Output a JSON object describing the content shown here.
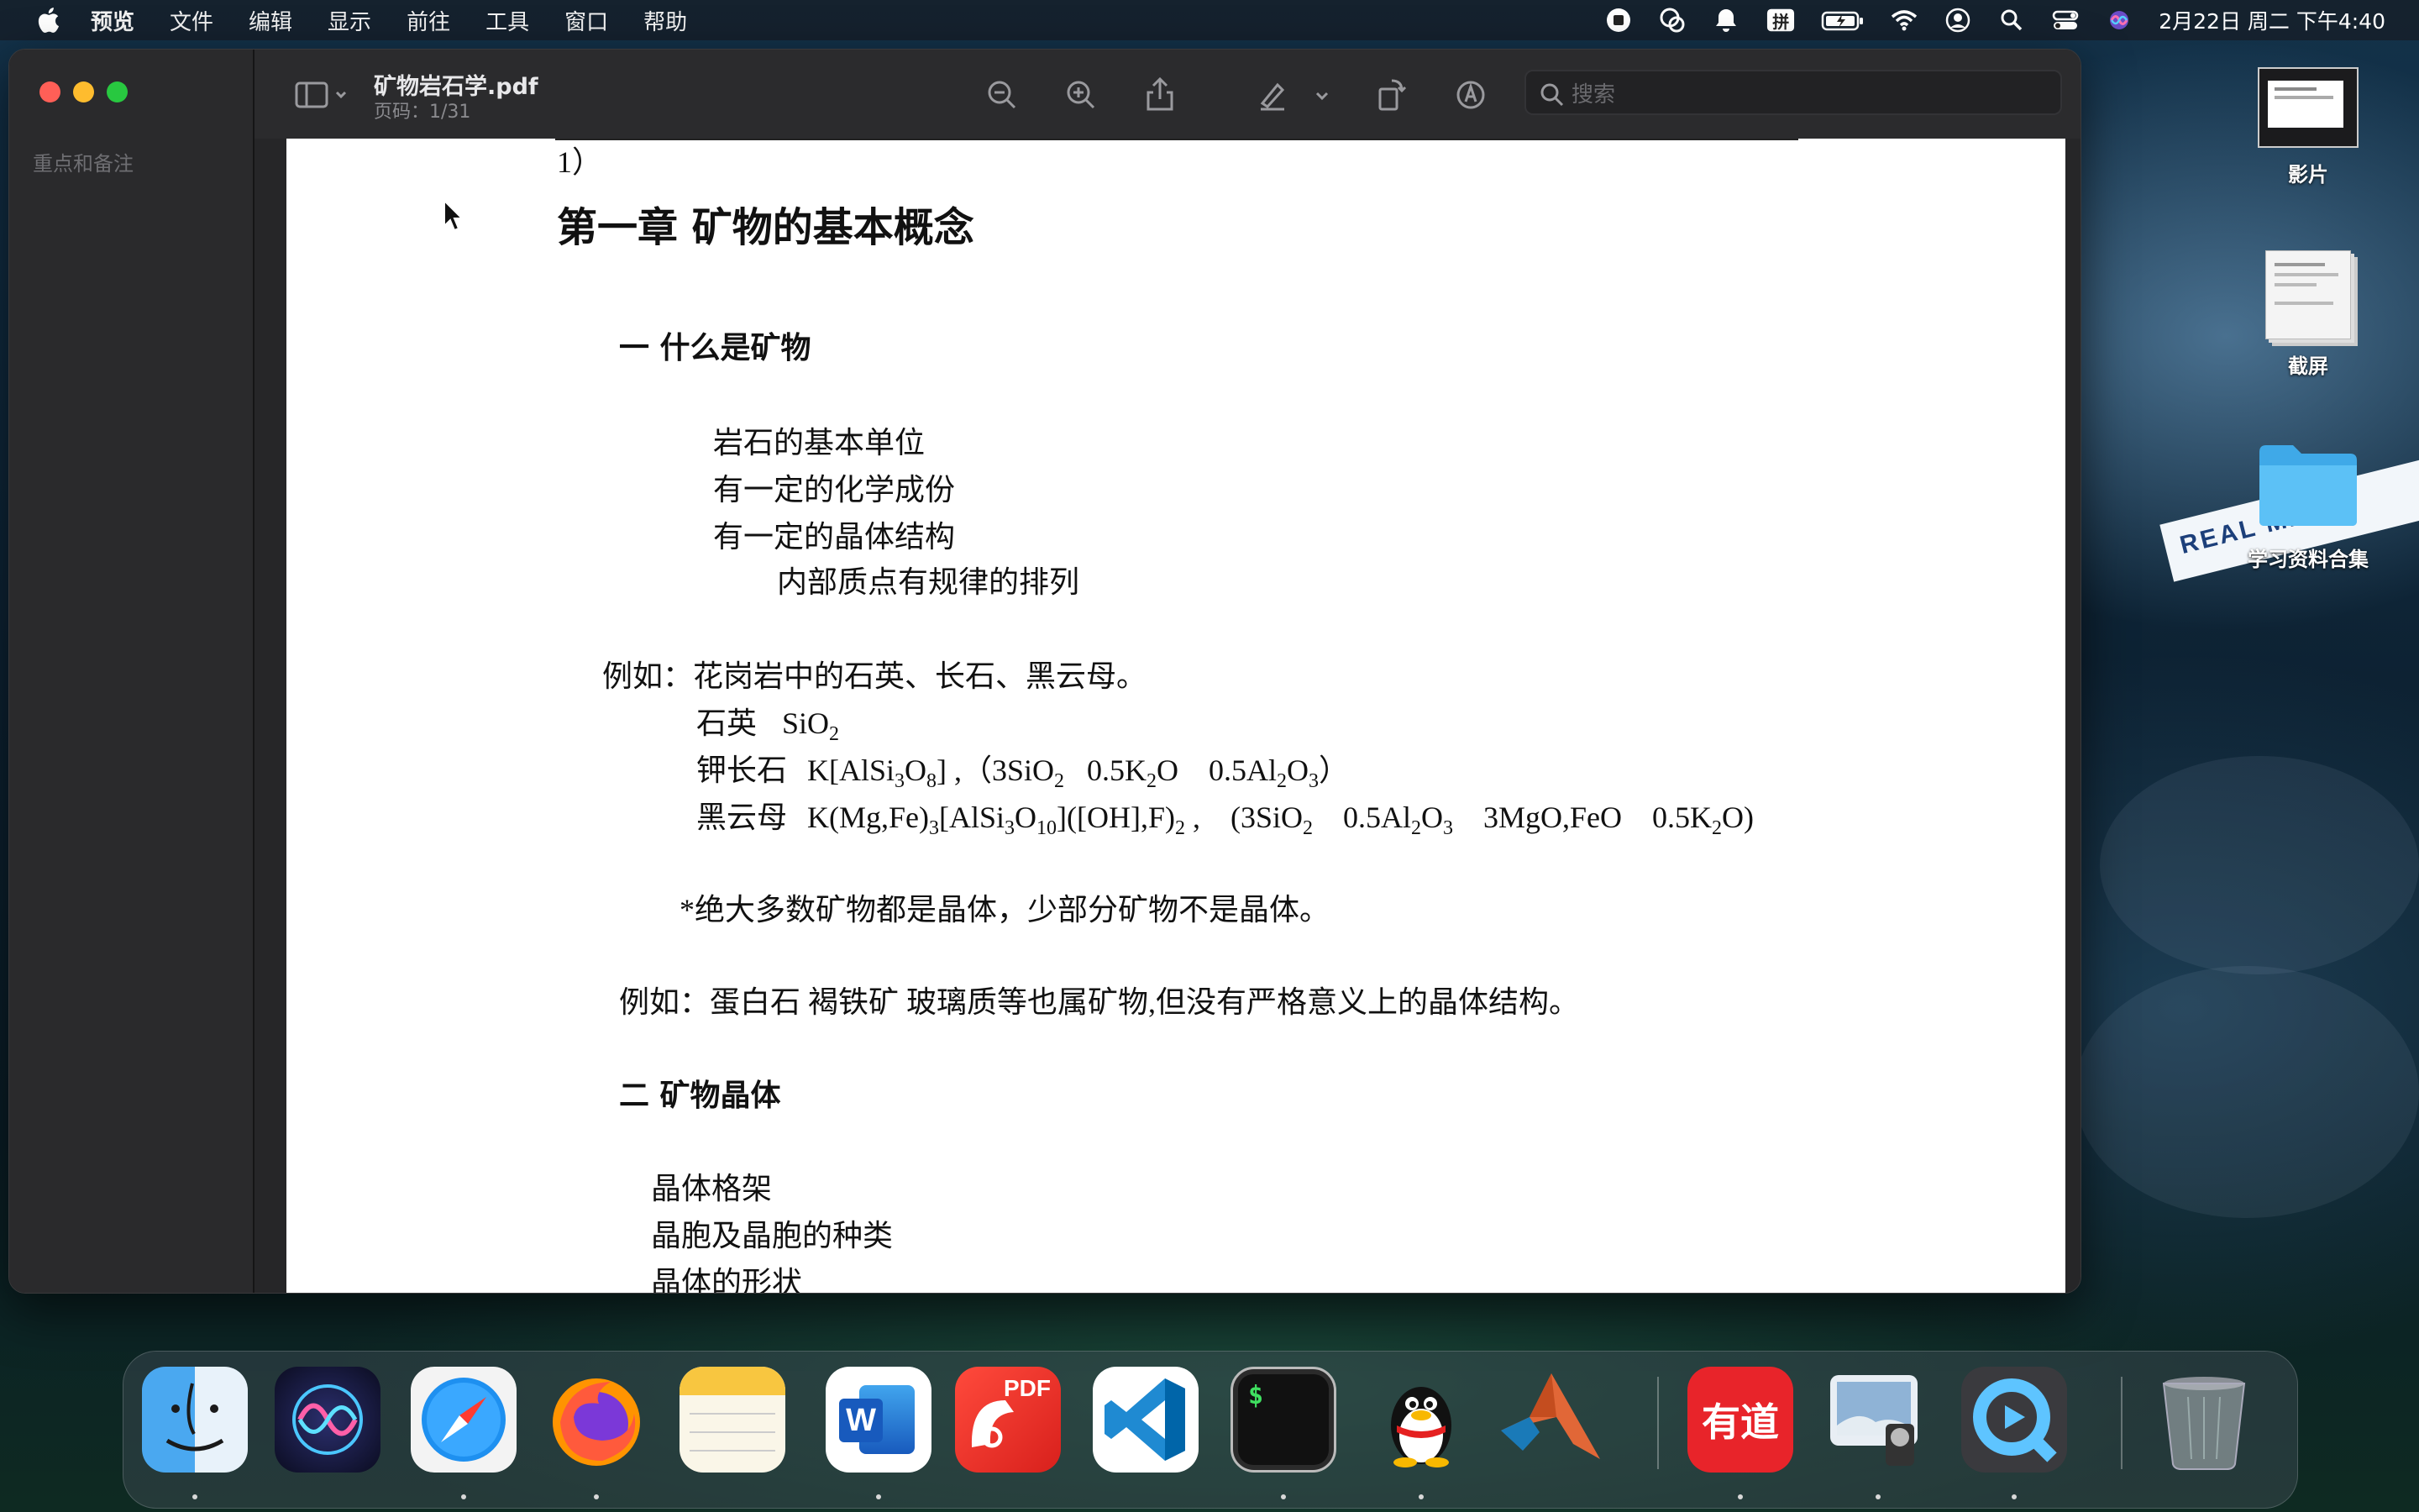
{
  "menubar": {
    "app_name": "预览",
    "items": [
      "文件",
      "编辑",
      "显示",
      "前往",
      "工具",
      "窗口",
      "帮助"
    ],
    "clock": "2月22日 周二 下午4:40",
    "input_method": "拼"
  },
  "window": {
    "sidebar_label": "重点和备注",
    "doc_title": "矿物岩石学.pdf",
    "page_info": "页码：1/31",
    "search_placeholder": "搜索"
  },
  "document": {
    "top_fragment": "1）",
    "chapter_title": "第一章  矿物的基本概念",
    "section1": "一  什么是矿物",
    "bullets": [
      "岩石的基本单位",
      "有一定的化学成份",
      "有一定的晶体结构"
    ],
    "sub_bullet": "内部质点有规律的排列",
    "example1_intro": "例如：花岗岩中的石英、长石、黑云母。",
    "quartz_label": "石英",
    "quartz_formula_pre": "SiO",
    "quartz_formula_sub": "2",
    "feldspar_label": "钾长石",
    "biotite_label": "黑云母",
    "note": "*绝大多数矿物都是晶体，少部分矿物不是晶体。",
    "example2": "例如：蛋白石  褐铁矿  玻璃质等也属矿物,但没有严格意义上的晶体结构。",
    "section2": "二  矿物晶体",
    "list2": [
      "晶体格架",
      "晶胞及晶胞的种类",
      "晶体的形状"
    ]
  },
  "desktop_icons": [
    "影片",
    "截屏",
    "学习资料合集"
  ],
  "wallpaper": {
    "banner_text": "REAL MA"
  },
  "dock": {
    "apps": [
      "Finder",
      "Siri",
      "Safari",
      "Firefox",
      "Notes",
      "Word",
      "PDF Expert",
      "VS Code",
      "Terminal",
      "QQ",
      "MATLAB",
      "有道",
      "Preview",
      "QuickTime",
      "Trash"
    ],
    "youdao_text": "有道",
    "pdf_text": "PDF",
    "word_text": "W",
    "terminal_text": "$"
  }
}
